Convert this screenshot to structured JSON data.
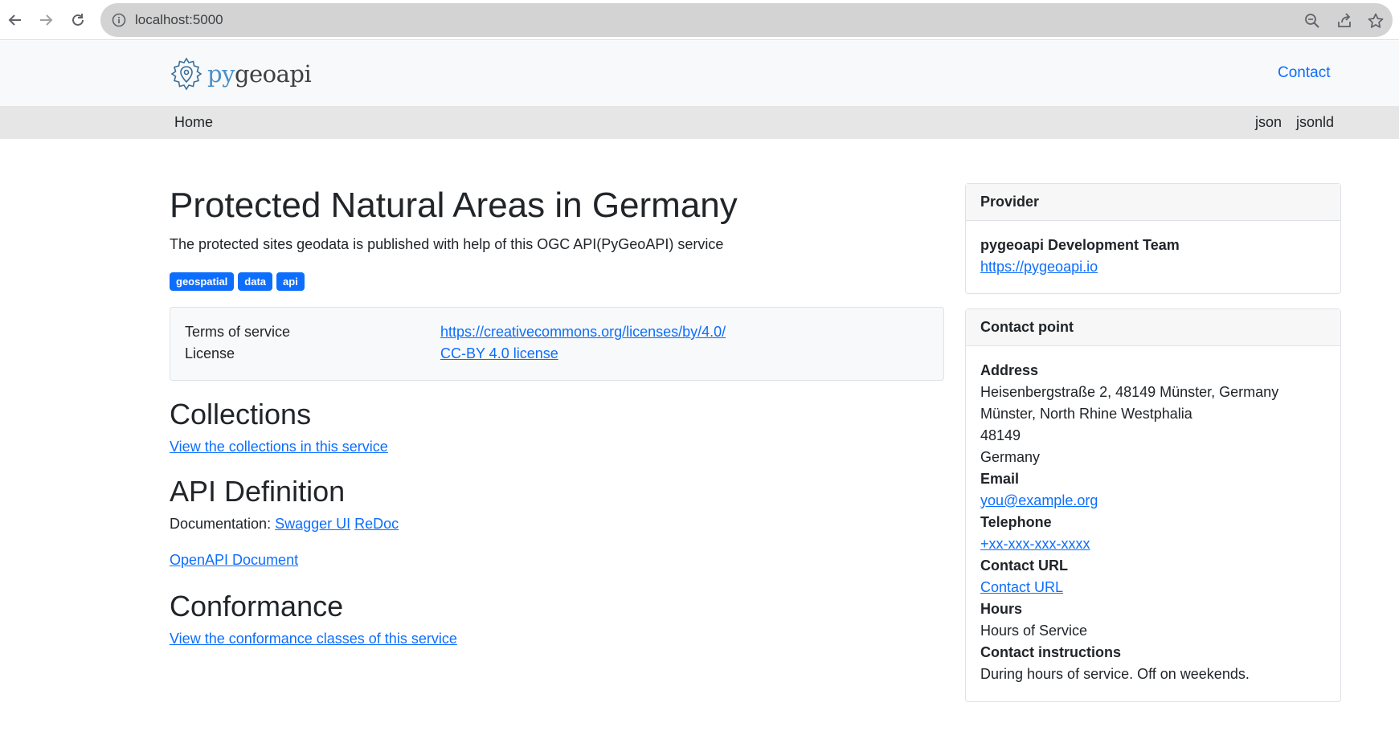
{
  "browser": {
    "url": "localhost:5000"
  },
  "header": {
    "logo": {
      "py": "py",
      "rest": "geoapi"
    },
    "contact_label": "Contact"
  },
  "navbar": {
    "home": "Home",
    "json": "json",
    "jsonld": "jsonld"
  },
  "main": {
    "title": "Protected Natural Areas in Germany",
    "description": "The protected sites geodata is published with help of this OGC API(PyGeoAPI) service",
    "keywords": [
      "geospatial",
      "data",
      "api"
    ],
    "terms": {
      "tos_label": "Terms of service",
      "tos_value": "https://creativecommons.org/licenses/by/4.0/",
      "license_label": "License",
      "license_value": "CC-BY 4.0 license"
    },
    "collections": {
      "heading": "Collections",
      "link": "View the collections in this service"
    },
    "api": {
      "heading": "API Definition",
      "doc_label": "Documentation:",
      "swagger": "Swagger UI",
      "redoc": "ReDoc",
      "openapi": "OpenAPI Document"
    },
    "conformance": {
      "heading": "Conformance",
      "link": "View the conformance classes of this service"
    }
  },
  "provider": {
    "heading": "Provider",
    "name": "pygeoapi Development Team",
    "url": "https://pygeoapi.io"
  },
  "contact_point": {
    "heading": "Contact point",
    "address_label": "Address",
    "address_line": "Heisenbergstraße 2, 48149 Münster, Germany",
    "city_line": "Münster, North Rhine Westphalia",
    "postal": "48149",
    "country": "Germany",
    "email_label": "Email",
    "email": "you@example.org",
    "phone_label": "Telephone",
    "phone": "+xx-xxx-xxx-xxxx",
    "url_label": "Contact URL",
    "url": "Contact URL",
    "hours_label": "Hours",
    "hours": "Hours of Service",
    "instructions_label": "Contact instructions",
    "instructions": "During hours of service. Off on weekends."
  },
  "colors": {
    "link": "#0d6efd",
    "badge": "#0d6efd",
    "header_bg": "#f8f9fa",
    "navbar_bg": "#e6e6e6"
  }
}
